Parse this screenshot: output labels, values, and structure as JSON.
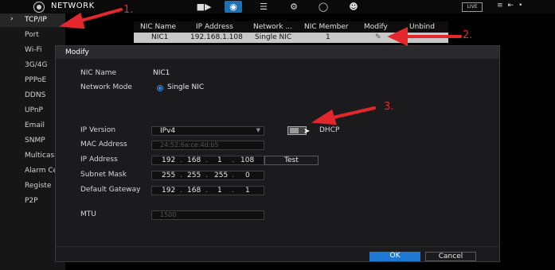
{
  "header": {
    "title": "NETWORK",
    "icons": [
      "camera-icon",
      "network-icon",
      "storage-icon",
      "settings-icon",
      "security-icon",
      "account-icon"
    ],
    "live_label": "LIVE"
  },
  "sidebar": {
    "items": [
      {
        "label": "TCP/IP",
        "active": true
      },
      {
        "label": "Port"
      },
      {
        "label": "Wi-Fi"
      },
      {
        "label": "3G/4G"
      },
      {
        "label": "PPPoE"
      },
      {
        "label": "DDNS"
      },
      {
        "label": "UPnP"
      },
      {
        "label": "Email"
      },
      {
        "label": "SNMP"
      },
      {
        "label": "Multicas"
      },
      {
        "label": "Alarm Ce"
      },
      {
        "label": "Registe"
      },
      {
        "label": "P2P"
      }
    ]
  },
  "nic_table": {
    "columns": [
      "NIC Name",
      "IP Address",
      "Network ...",
      "NIC Member",
      "Modify",
      "Unbind"
    ],
    "row": {
      "nic_name": "NIC1",
      "ip": "192.168.1.108",
      "network": "Single NIC",
      "member": "1"
    }
  },
  "dialog": {
    "title": "Modify",
    "nic_name_label": "NIC Name",
    "nic_name_value": "NIC1",
    "network_mode_label": "Network Mode",
    "network_mode_value": "Single NIC",
    "ip_version_label": "IP Version",
    "ip_version_value": "IPv4",
    "dhcp_label": "DHCP",
    "mac_label": "MAC Address",
    "mac_value": "24:52:6a:ce:4d:b5",
    "ip_label": "IP Address",
    "ip_octets": [
      "192",
      "168",
      "1",
      "108"
    ],
    "test_label": "Test",
    "mask_label": "Subnet Mask",
    "mask_octets": [
      "255",
      "255",
      "255",
      "0"
    ],
    "gateway_label": "Default Gateway",
    "gateway_octets": [
      "192",
      "168",
      "1",
      "1"
    ],
    "mtu_label": "MTU",
    "mtu_value": "1500",
    "ok_label": "OK",
    "cancel_label": "Cancel"
  },
  "annotations": {
    "a1": "1.",
    "a2": "2.",
    "a3": "3."
  },
  "colors": {
    "accent": "#1f6fb5",
    "arrow": "#e3272d",
    "ok_button": "#1f78d1"
  }
}
